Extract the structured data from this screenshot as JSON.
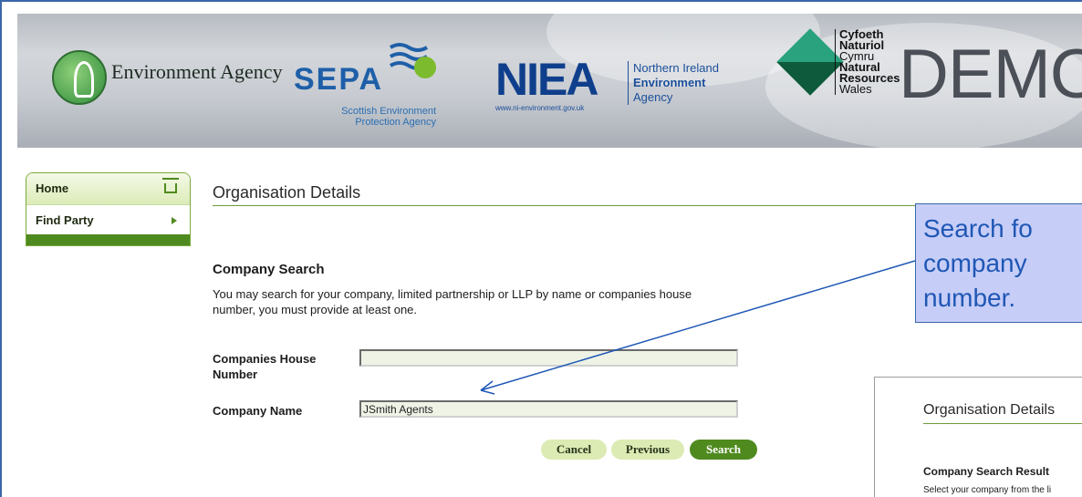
{
  "header": {
    "ea_name": "Environment Agency",
    "sepa_name": "SEPA",
    "sepa_subtitle": "Scottish Environment Protection Agency",
    "niea_mark": "NIEA",
    "niea_url": "www.ni-environment.gov.uk",
    "niea_line1": "Northern Ireland",
    "niea_line2": "Environment",
    "niea_line3": "Agency",
    "nrw_line1": "Cyfoeth",
    "nrw_line2": "Naturiol",
    "nrw_line3": "Cymru",
    "nrw_line4": "Natural",
    "nrw_line5": "Resources",
    "nrw_line6": "Wales",
    "demo_label": "DEMO"
  },
  "sidebar": {
    "items": [
      {
        "label": "Home",
        "icon": "home-icon"
      },
      {
        "label": "Find Party",
        "icon": "arrow-right-icon"
      }
    ]
  },
  "main": {
    "page_title": "Organisation Details",
    "section_title": "Company Search",
    "section_desc": "You may search for your company, limited partnership or LLP by name or companies house number, you must provide at least one.",
    "fields": {
      "companies_house_label": "Companies House Number",
      "companies_house_value": "",
      "company_name_label": "Company Name",
      "company_name_value": "JSmith Agents"
    },
    "buttons": {
      "cancel": "Cancel",
      "previous": "Previous",
      "search": "Search"
    }
  },
  "callout": {
    "text": "Search fo\ncompany\nnumber."
  },
  "inset": {
    "title": "Organisation Details",
    "subtitle": "Company Search Result",
    "desc": "Select your company from the li"
  },
  "colors": {
    "brand_green": "#4f8a1f",
    "light_green": "#dcebb3",
    "callout_fill": "#c6cdf7",
    "callout_text": "#1f57b5",
    "frame_blue": "#3a67a8"
  }
}
